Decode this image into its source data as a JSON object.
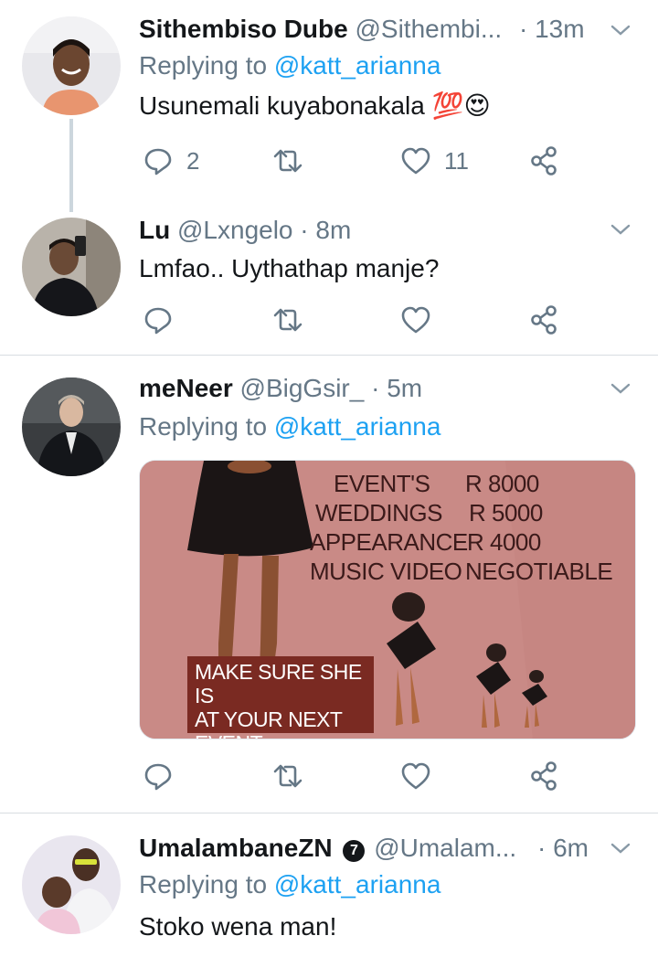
{
  "tweets": [
    {
      "name": "Sithembiso Dube",
      "handle": "@Sithembi...",
      "dot": "·",
      "time": "13m",
      "replying_prefix": "Replying to ",
      "replying_to": "@katt_arianna",
      "text": "Usunemali kuyabonakala 💯😍",
      "reply_count": "2",
      "like_count": "11"
    },
    {
      "name": "Lu",
      "handle": "@Lxngelo",
      "dot": "·",
      "time": "8m",
      "text": "Lmfao.. Uythathap manje?"
    },
    {
      "name": "meNeer",
      "handle": "@BigGsir_",
      "dot": "·",
      "time": "5m",
      "replying_prefix": "Replying to ",
      "replying_to": "@katt_arianna",
      "media": {
        "lines": [
          {
            "label": "EVENT'S",
            "price": "R 8000"
          },
          {
            "label": "WEDDINGS",
            "price": "R 5000"
          },
          {
            "label": "APPEARANCE",
            "price": "R 4000"
          },
          {
            "label": "MUSIC VIDEO",
            "price": "NEGOTIABLE"
          }
        ],
        "box_line1": "MAKE SURE SHE IS",
        "box_line2": "AT YOUR NEXT",
        "box_line3": "EVENT"
      }
    },
    {
      "name": "UmalambaneZN",
      "badge": "7",
      "handle": "@Umalam...",
      "dot": "·",
      "time": "6m",
      "replying_prefix": "Replying to ",
      "replying_to": "@katt_arianna",
      "text": "Stoko wena man!"
    }
  ],
  "colors": {
    "link": "#1da1f2",
    "muted": "#657786",
    "text": "#14171a",
    "thread_line": "#ccd6dd"
  },
  "icons": [
    "reply-icon",
    "retweet-icon",
    "like-icon",
    "share-icon",
    "chevron-down-icon",
    "badge-icon"
  ]
}
